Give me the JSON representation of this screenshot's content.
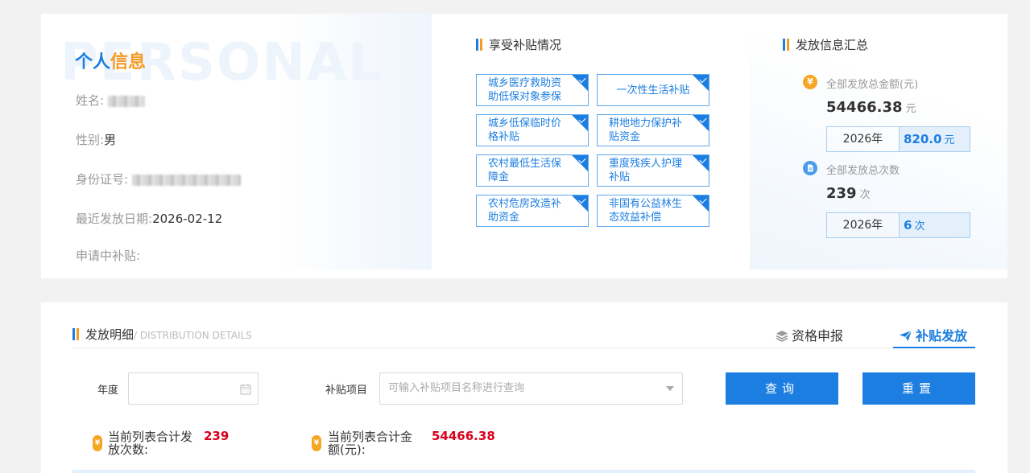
{
  "personal": {
    "watermark": "PERSONAL",
    "title_a": "个人",
    "title_b": "信息",
    "name_label": "姓名:",
    "gender_label": "性别:",
    "gender_value": "男",
    "id_label": "身份证号:",
    "last_date_label": "最近发放日期:",
    "last_date_value": "2026-02-12",
    "applying_label": "申请中补贴:"
  },
  "subsidies": {
    "title": "享受补贴情况",
    "tags": [
      "城乡医疗救助资助低保对象参保",
      "一次性生活补贴",
      "城乡低保临时价格补贴",
      "耕地地力保护补贴资金",
      "农村最低生活保障金",
      "重度残疾人护理补贴",
      "农村危房改造补助资金",
      "非国有公益林生态效益补偿"
    ]
  },
  "summary": {
    "title": "发放信息汇总",
    "amount_icon": "¥",
    "amount_label": "全部发放总金额(元)",
    "amount_value": "54466.38",
    "amount_unit": "元",
    "amount_year": "2026年",
    "amount_year_value": "820.0",
    "count_label": "全部发放总次数",
    "count_value": "239",
    "count_unit": "次",
    "count_year": "2026年",
    "count_year_value": "6"
  },
  "details": {
    "title": "发放明细",
    "subtitle": "/ DISTRIBUTION DETAILS",
    "tab_apply": "资格申报",
    "tab_distribute": "补贴发放",
    "year_label": "年度",
    "project_label": "补贴项目",
    "project_placeholder": "可输入补贴项目名称进行查询",
    "query_button": "查询",
    "reset_button": "重置",
    "count_stat_label": "当前列表合计发放次数:",
    "count_stat_value": "239",
    "amount_stat_label": "当前列表合计金额(元):",
    "amount_stat_value": "54466.38"
  },
  "colors": {
    "primary": "#1c7ee0",
    "accent": "#f59a23",
    "danger": "#d9001b"
  }
}
